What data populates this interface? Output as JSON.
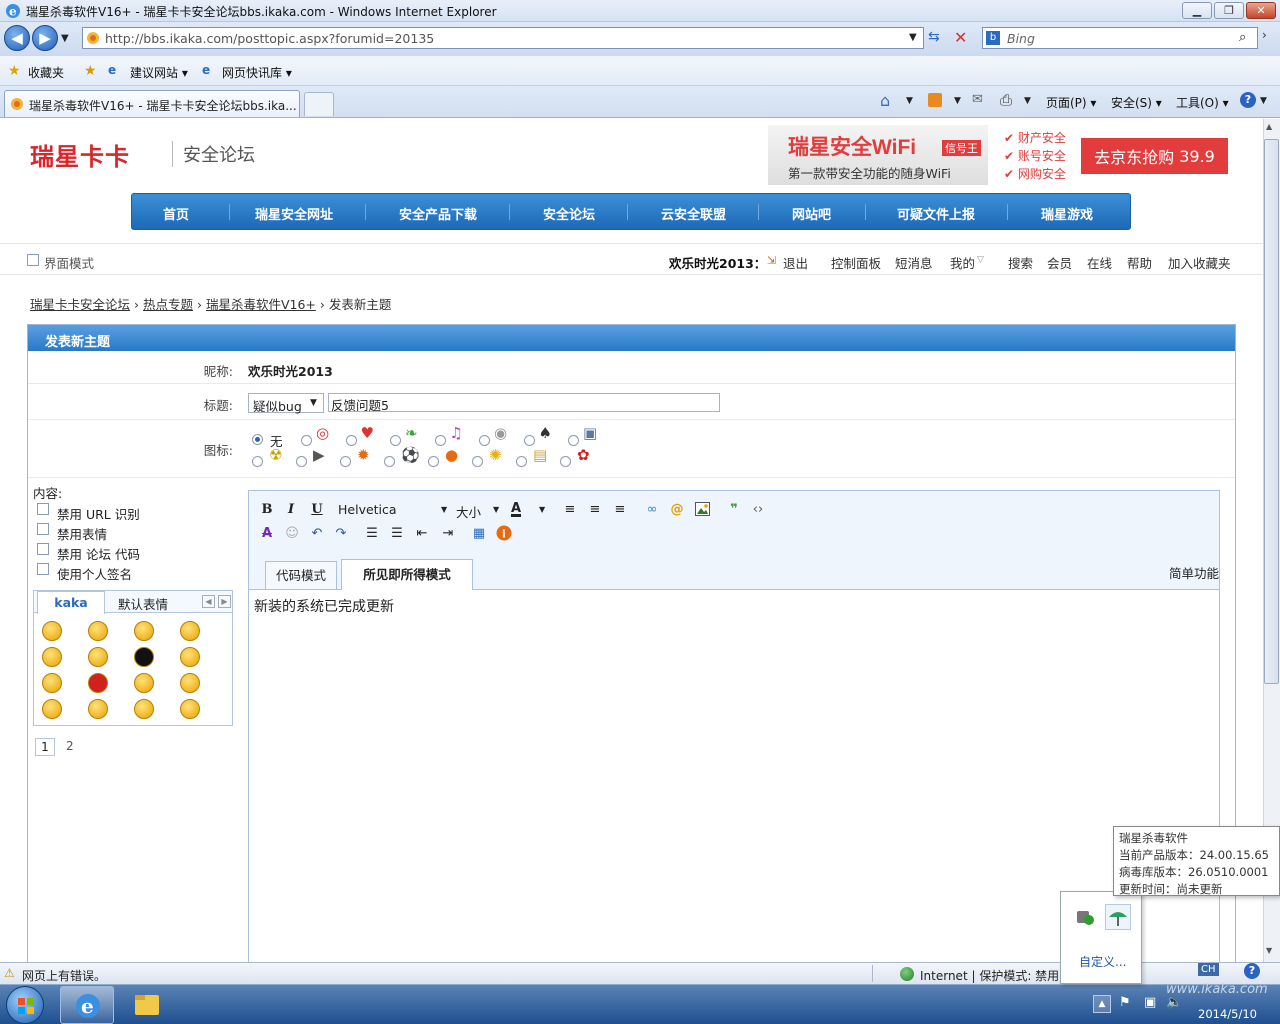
{
  "window": {
    "title": "瑞星杀毒软件V16+ - 瑞星卡卡安全论坛bbs.ikaka.com - Windows Internet Explorer",
    "min_label": "▁",
    "max_label": "❐",
    "close_label": "✕"
  },
  "navbar": {
    "url": "http://bbs.ikaka.com/posttopic.aspx?forumid=20135",
    "search_placeholder": "Bing"
  },
  "favorites": {
    "favorites_label": "收藏夹",
    "suggested_label": "建议网站 ▾",
    "webslice_label": "网页快讯库 ▾"
  },
  "tabs": {
    "active_tab": "瑞星杀毒软件V16+ - 瑞星卡卡安全论坛bbs.ika...",
    "commands": {
      "page": "页面(P) ▾",
      "safety": "安全(S) ▾",
      "tools": "工具(O) ▾"
    }
  },
  "site": {
    "logo": "瑞星卡卡",
    "logo_sub": "安全论坛",
    "banner": {
      "headline": "瑞星安全WiFi",
      "badge": "信号王",
      "tagline": "第一款带安全功能的随身WiFi",
      "checks": [
        "财产安全",
        "账号安全",
        "网购安全"
      ],
      "cta": "去京东抢购",
      "price": "39.9"
    },
    "nav": [
      "首页",
      "瑞星安全网址",
      "安全产品下载",
      "安全论坛",
      "云安全联盟",
      "网站吧",
      "可疑文件上报",
      "瑞星游戏"
    ]
  },
  "subbar": {
    "mode_label": "界面模式",
    "username": "欢乐时光2013：",
    "logout": "退出",
    "links": [
      "控制面板",
      "短消息",
      "我的",
      "搜索",
      "会员",
      "在线",
      "帮助",
      "加入收藏夹"
    ]
  },
  "breadcrumb": {
    "items": [
      "瑞星卡卡安全论坛",
      "热点专题",
      "瑞星杀毒软件V16+"
    ],
    "current": "发表新主题",
    "sep": "›"
  },
  "form": {
    "header": "发表新主题",
    "nickname_label": "昵称:",
    "nickname": "欢乐时光2013",
    "subject_label": "标题:",
    "subject_type": "疑似bug",
    "subject": "反馈问题5",
    "icon_label": "图标:",
    "icon_none": "无",
    "content_label": "内容:",
    "options": [
      "禁用 URL 识别",
      "禁用表情",
      "禁用 论坛 代码",
      "使用个人签名"
    ],
    "smiley_tabs": [
      "kaka",
      "默认表情"
    ],
    "smiley_pages": [
      "1",
      "2"
    ]
  },
  "editor": {
    "font": "Helvetica",
    "size": "大小",
    "tab_code": "代码模式",
    "tab_wysiwyg": "所见即所得模式",
    "simple": "简单功能",
    "content": "新装的系统已完成更新"
  },
  "status": {
    "error": "网页上有错误。",
    "zone": "Internet | 保护模式: 禁用"
  },
  "tooltip": {
    "title": "瑞星杀毒软件",
    "product_version_label": "当前产品版本：",
    "product_version": "24.00.15.65",
    "db_version_label": "病毒库版本：",
    "db_version": "26.0510.0001",
    "update_label": "更新时间：",
    "update": "尚未更新"
  },
  "tray": {
    "customize": "自定义...",
    "lang": "CH",
    "date": "2014/5/10",
    "watermark": "www.ikaka.com"
  },
  "colors": {
    "nav_blue": "#1d69b7",
    "logo_red": "#d8262b",
    "banner_red": "#e23c3c"
  }
}
